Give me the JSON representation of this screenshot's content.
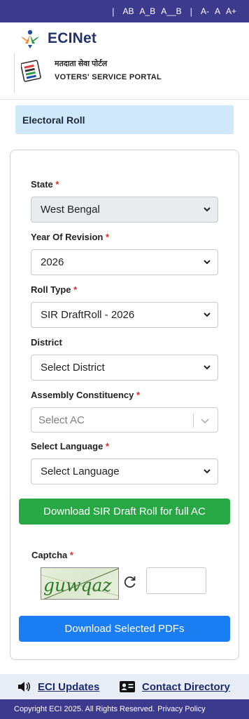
{
  "topbar": {
    "text_ab": "AB",
    "text_a_b": "A_B",
    "text_a__b": "A__B",
    "font_minus": "A-",
    "font_normal": "A",
    "font_plus": "A+"
  },
  "header": {
    "brand": "ECINet",
    "portal_hindi": "मतदाता सेवा पोर्टल",
    "portal_english": "VOTERS' SERVICE PORTAL"
  },
  "page": {
    "section_title": "Electoral Roll"
  },
  "form": {
    "state": {
      "label": "State",
      "value": "West Bengal"
    },
    "year": {
      "label": "Year Of Revision",
      "value": "2026"
    },
    "roll_type": {
      "label": "Roll Type",
      "value": "SIR DraftRoll - 2026"
    },
    "district": {
      "label": "District",
      "value": "Select District"
    },
    "ac": {
      "label": "Assembly Constituency",
      "placeholder": "Select AC"
    },
    "language": {
      "label": "Select Language",
      "value": "Select Language"
    },
    "required_mark": "*"
  },
  "buttons": {
    "download_full": "Download SIR Draft Roll for full AC",
    "download_selected": "Download Selected PDFs"
  },
  "captcha": {
    "label": "Captcha",
    "text": "guwqaz"
  },
  "footer": {
    "eci_updates": "ECI Updates",
    "contact_directory": "Contact Directory",
    "copyright": "Copyright ECI 2025. All Rights Reserved.",
    "privacy": "Privacy Policy"
  },
  "colors": {
    "topbar": "#3b3a8c",
    "section_bg": "#cfe9fb",
    "green_button": "#28a745",
    "blue_button": "#1a7df2",
    "brand_text": "#23336b"
  }
}
